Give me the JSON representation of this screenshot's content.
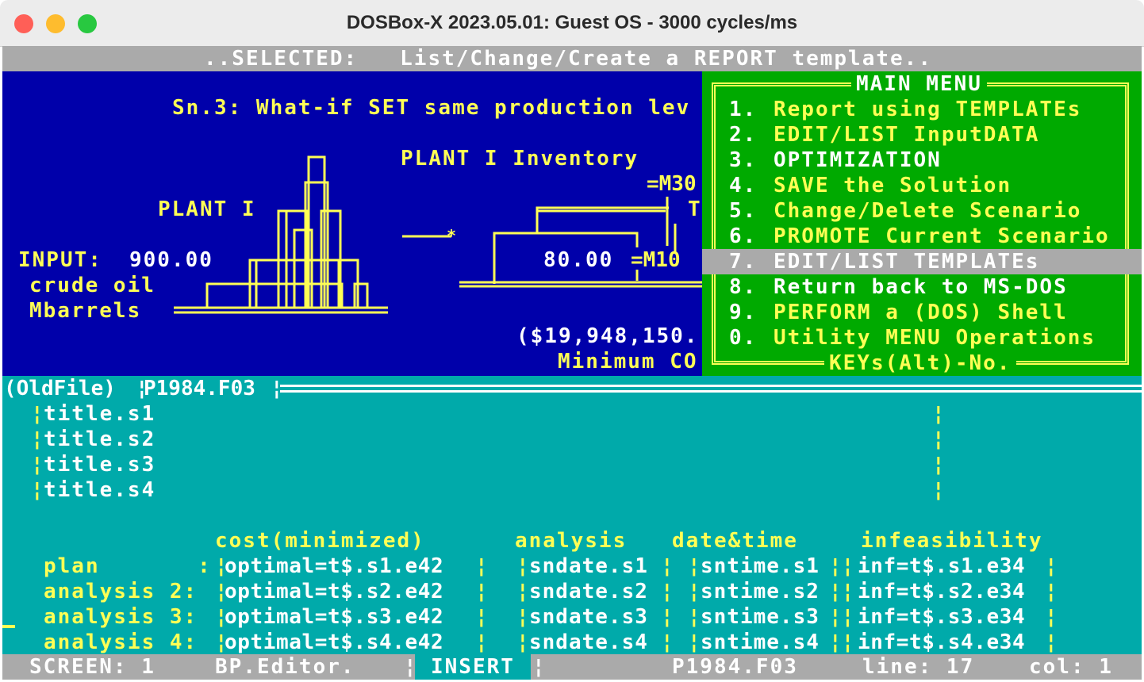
{
  "window": {
    "title": "DOSBox-X 2023.05.01: Guest OS - 3000 cycles/ms"
  },
  "colors": {
    "blue_panel": "#0000aa",
    "menu_green": "#00aa00",
    "editor_cyan": "#00aaaa",
    "highlight_gray": "#aaaaaa",
    "yellow": "#ffff55"
  },
  "selected_bar": "..SELECTED:   List/Change/Create a REPORT template..",
  "diagram": {
    "scenario_title": "Sn.3: What-if SET same production lev",
    "plant_label": "PLANT I",
    "inventory_label": "PLANT I Inventory",
    "m30": "=M30",
    "t_label": "T",
    "input_label": "INPUT:",
    "input_value": "900.00",
    "crude_oil": "crude oil",
    "mbarrels": "Mbarrels",
    "inv_value": "80.00",
    "m10": "=M10",
    "cost_value": "($19,948,150.",
    "minimum_cost": "Minimum CO"
  },
  "main_menu": {
    "title": "MAIN MENU",
    "footer": "KEYs(Alt)-No.",
    "items": [
      {
        "num": "1.",
        "label": "Report using TEMPLATEs"
      },
      {
        "num": "2.",
        "label": "EDIT/LIST InputDATA"
      },
      {
        "num": "3.",
        "label": "OPTIMIZATION"
      },
      {
        "num": "4.",
        "label": "SAVE the Solution"
      },
      {
        "num": "5.",
        "label": "Change/Delete Scenario"
      },
      {
        "num": "6.",
        "label": "PROMOTE Current Scenario"
      },
      {
        "num": "7.",
        "label": "EDIT/LIST TEMPLATEs"
      },
      {
        "num": "8.",
        "label": "Return back to MS-DOS"
      },
      {
        "num": "9.",
        "label": "PERFORM a (DOS) Shell"
      },
      {
        "num": "0.",
        "label": "Utility MENU Operations"
      }
    ],
    "selected_index": 6
  },
  "file_bar": {
    "prefix": "(OldFile)",
    "filename": "P1984.F03"
  },
  "editor": {
    "titles": [
      "title.s1",
      "title.s2",
      "title.s3",
      "title.s4"
    ],
    "headers": [
      "cost(minimized)",
      "analysis",
      "date&time",
      "infeasibility"
    ],
    "rows": [
      {
        "label": "plan       :",
        "optimal": "optimal=t$.s1.e42",
        "sndate": "sndate.s1",
        "sntime": "sntime.s1",
        "inf": "inf=t$.s1.e34"
      },
      {
        "label": "analysis 2:",
        "optimal": "optimal=t$.s2.e42",
        "sndate": "sndate.s2",
        "sntime": "sntime.s2",
        "inf": "inf=t$.s2.e34"
      },
      {
        "label": "analysis 3:",
        "optimal": "optimal=t$.s3.e42",
        "sndate": "sndate.s3",
        "sntime": "sntime.s3",
        "inf": "inf=t$.s3.e34"
      },
      {
        "label": "analysis 4:",
        "optimal": "optimal=t$.s4.e42",
        "sndate": "sndate.s4",
        "sntime": "sntime.s4",
        "inf": "inf=t$.s4.e34"
      }
    ]
  },
  "status": {
    "screen": "SCREEN: 1",
    "editor": "BP.Editor.",
    "mode": "INSERT",
    "file": "P1984.F03",
    "line": "line: 17",
    "col": "col: 1"
  }
}
